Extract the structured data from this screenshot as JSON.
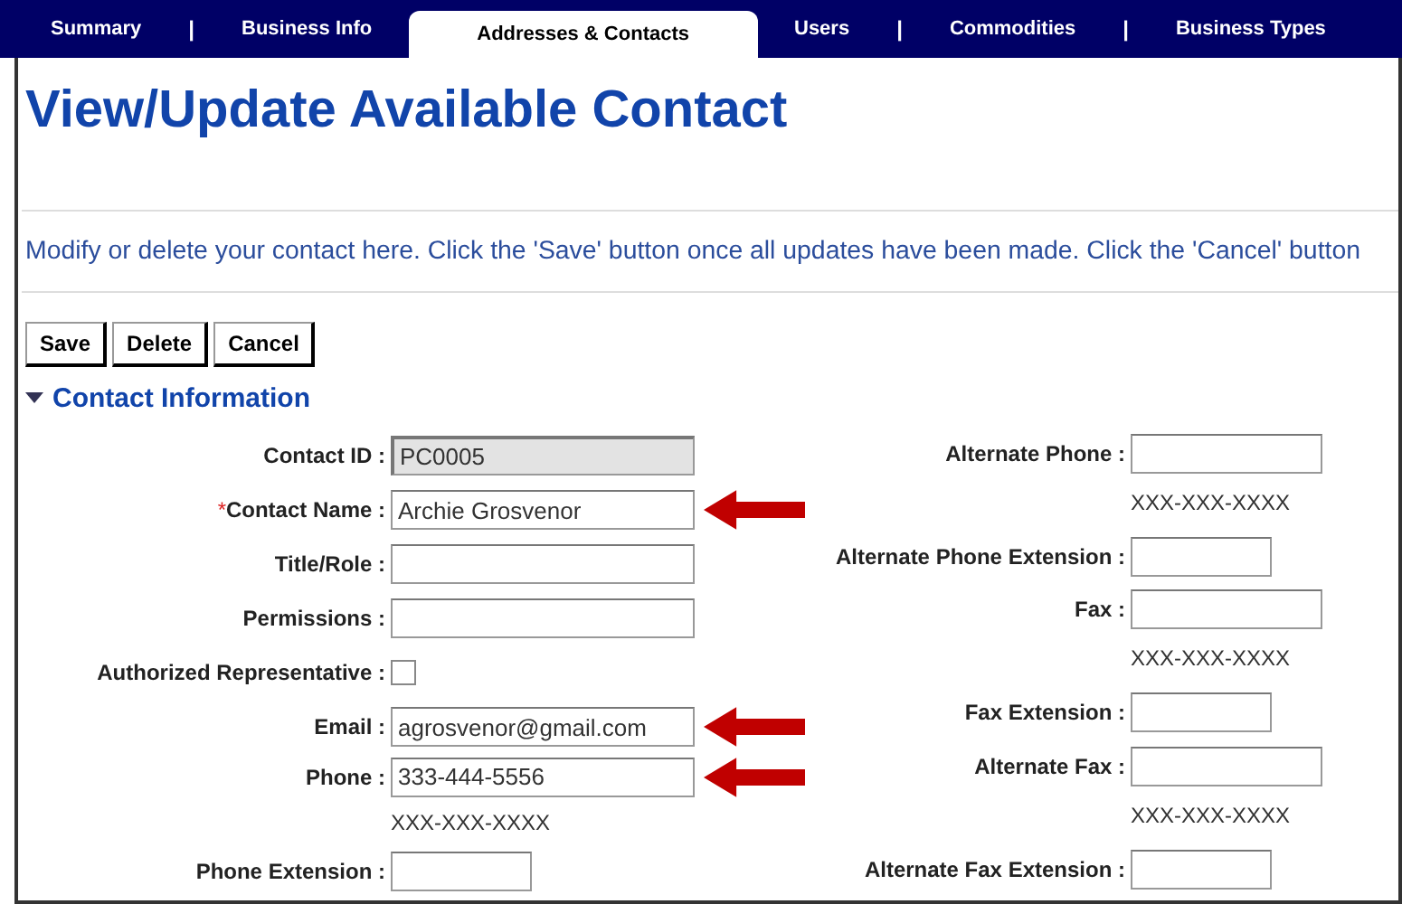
{
  "nav": [
    {
      "kind": "tab",
      "label": "Summary",
      "selected": false
    },
    {
      "kind": "separator",
      "label": "|"
    },
    {
      "kind": "tab",
      "label": "Business Info",
      "selected": false
    },
    {
      "kind": "tab",
      "label": "Addresses & Contacts",
      "selected": true
    },
    {
      "kind": "tab",
      "label": "Users",
      "selected": false
    },
    {
      "kind": "separator",
      "label": "|"
    },
    {
      "kind": "tab",
      "label": "Commodities",
      "selected": false
    },
    {
      "kind": "separator",
      "label": "|"
    },
    {
      "kind": "tab",
      "label": "Business Types",
      "selected": false
    }
  ],
  "title": "View/Update Available Contact",
  "description": "Modify or delete your contact here. Click the 'Save' button once all updates have been made. Click the 'Cancel' button",
  "buttons": [
    "Save",
    "Delete",
    "Cancel"
  ],
  "section": {
    "title": "Contact Information",
    "expanded": true
  },
  "left_fields": [
    {
      "kind": "text",
      "label": "Contact ID :",
      "value": "PC0005",
      "disabled": true,
      "highlighted": false
    },
    {
      "kind": "text",
      "label": "Contact Name :",
      "required_mark": "*",
      "value": "Archie Grosvenor",
      "disabled": false,
      "highlighted": true
    },
    {
      "kind": "text",
      "label": "Title/Role :",
      "disabled": false,
      "highlighted": false
    },
    {
      "kind": "text",
      "label": "Permissions :",
      "disabled": false,
      "highlighted": false
    },
    {
      "kind": "checkbox",
      "label": "Authorized Representative :",
      "checked": false,
      "highlighted": false
    },
    {
      "kind": "text",
      "label": "Email :",
      "value": "agrosvenor@gmail.com",
      "disabled": false,
      "highlighted": true
    },
    {
      "kind": "text",
      "label": "Phone :",
      "value": "333-444-5556",
      "hint": "XXX-XXX-XXXX",
      "disabled": false,
      "highlighted": true
    },
    {
      "kind": "short_text",
      "label": "Phone Extension :",
      "disabled": false,
      "highlighted": false
    }
  ],
  "right_fields": [
    {
      "kind": "text",
      "label": "Alternate Phone :",
      "hint": "XXX-XXX-XXXX",
      "disabled": false
    },
    {
      "kind": "short_text",
      "label": "Alternate Phone Extension :",
      "disabled": false
    },
    {
      "kind": "text",
      "label": "Fax :",
      "hint": "XXX-XXX-XXXX",
      "disabled": false
    },
    {
      "kind": "short_text",
      "label": "Fax Extension :",
      "disabled": false
    },
    {
      "kind": "text",
      "label": "Alternate Fax :",
      "hint": "XXX-XXX-XXXX",
      "disabled": false
    },
    {
      "kind": "short_text",
      "label": "Alternate Fax Extension :",
      "disabled": false
    }
  ]
}
